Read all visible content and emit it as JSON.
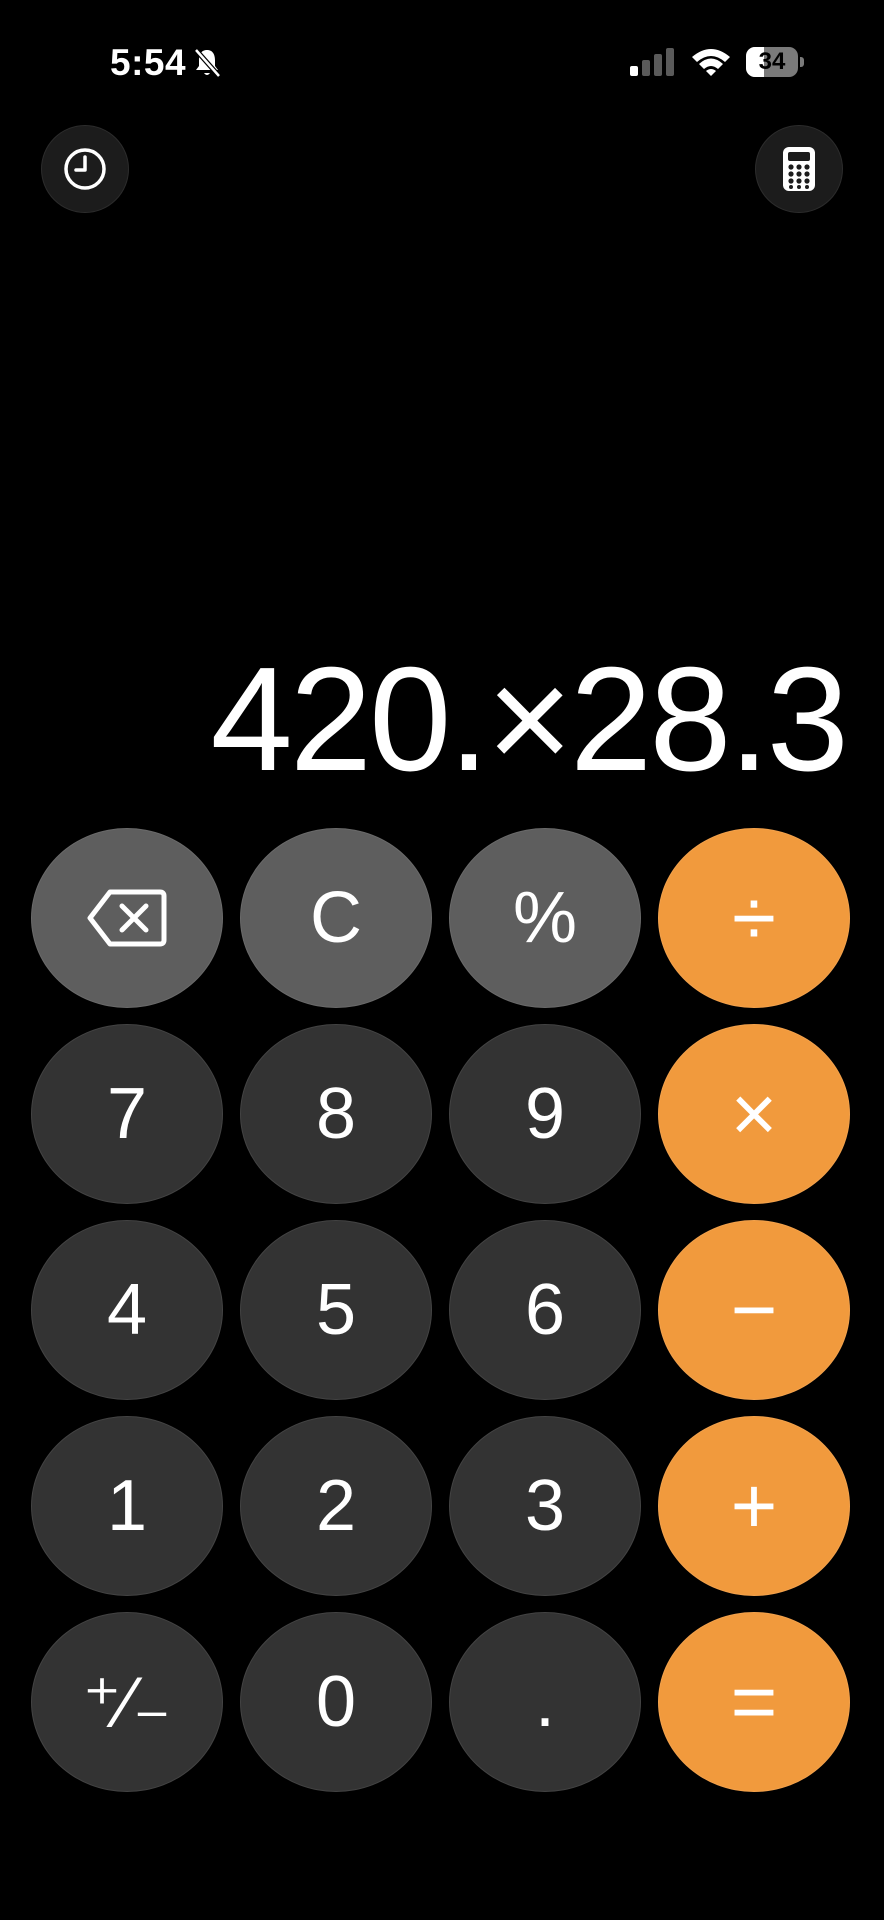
{
  "status_bar": {
    "time": "5:54",
    "battery_level": "34",
    "battery_percent": 34,
    "icons": [
      "bell-slash-icon",
      "signal-icon",
      "wifi-icon",
      "battery-icon"
    ]
  },
  "top_buttons": {
    "history_icon": "clock-icon",
    "mode_icon": "calculator-icon"
  },
  "display": {
    "expression": "420.×28.3"
  },
  "keypad": {
    "rows": [
      [
        {
          "label": "",
          "icon": "backspace-icon",
          "kind": "func"
        },
        {
          "label": "C",
          "kind": "func"
        },
        {
          "label": "%",
          "kind": "func"
        },
        {
          "label": "÷",
          "kind": "op"
        }
      ],
      [
        {
          "label": "7",
          "kind": "num"
        },
        {
          "label": "8",
          "kind": "num"
        },
        {
          "label": "9",
          "kind": "num"
        },
        {
          "label": "×",
          "kind": "op"
        }
      ],
      [
        {
          "label": "4",
          "kind": "num"
        },
        {
          "label": "5",
          "kind": "num"
        },
        {
          "label": "6",
          "kind": "num"
        },
        {
          "label": "−",
          "kind": "op"
        }
      ],
      [
        {
          "label": "1",
          "kind": "num"
        },
        {
          "label": "2",
          "kind": "num"
        },
        {
          "label": "3",
          "kind": "num"
        },
        {
          "label": "+",
          "kind": "op"
        }
      ],
      [
        {
          "label": "⁺∕₋",
          "kind": "num"
        },
        {
          "label": "0",
          "kind": "num"
        },
        {
          "label": ".",
          "kind": "num"
        },
        {
          "label": "=",
          "kind": "op"
        }
      ]
    ]
  },
  "colors": {
    "background": "#000000",
    "number_key": "#333333",
    "function_key": "#5e5e5e",
    "operator_key": "#f19a3d",
    "text": "#ffffff"
  }
}
